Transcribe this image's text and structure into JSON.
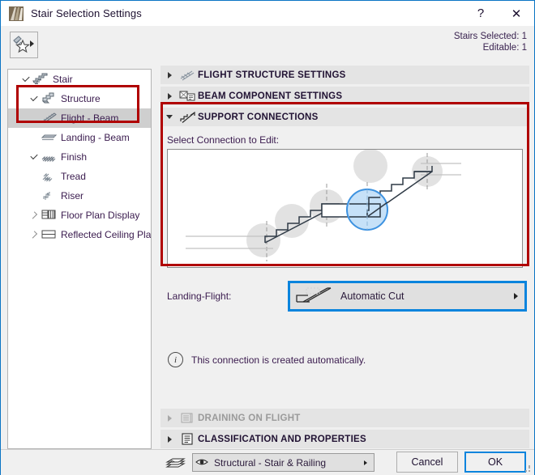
{
  "window": {
    "title": "Stair Selection Settings",
    "app_icon": "stair-app-icon",
    "help_label": "?",
    "close_label": "✕"
  },
  "header": {
    "favorites_icon": "favorites-star-icon",
    "stairs_selected": "Stairs Selected: 1",
    "editable": "Editable: 1"
  },
  "sidebar": {
    "items": [
      {
        "label": "Stair",
        "icon": "stair-icon",
        "indent": 0,
        "twisty": "open",
        "selected": false
      },
      {
        "label": "Structure",
        "icon": "structure-icon",
        "indent": 1,
        "twisty": "open",
        "selected": false
      },
      {
        "label": "Flight - Beam",
        "icon": "flight-beam-icon",
        "indent": 2,
        "twisty": "none",
        "selected": true
      },
      {
        "label": "Landing - Beam",
        "icon": "landing-beam-icon",
        "indent": 2,
        "twisty": "none",
        "selected": false
      },
      {
        "label": "Finish",
        "icon": "finish-icon",
        "indent": 1,
        "twisty": "open",
        "selected": false
      },
      {
        "label": "Tread",
        "icon": "tread-icon",
        "indent": 2,
        "twisty": "none",
        "selected": false
      },
      {
        "label": "Riser",
        "icon": "riser-icon",
        "indent": 2,
        "twisty": "none",
        "selected": false
      },
      {
        "label": "Floor Plan Display",
        "icon": "floor-plan-display-icon",
        "indent": 1,
        "twisty": "closed",
        "selected": false
      },
      {
        "label": "Reflected Ceiling Plan",
        "icon": "reflected-ceiling-plan-icon",
        "indent": 1,
        "twisty": "closed",
        "selected": false
      }
    ],
    "scroll_left_icon": "scroll-left-arrow-icon",
    "scroll_right_icon": "scroll-right-arrow-icon"
  },
  "main": {
    "sections_top": [
      {
        "title": "FLIGHT STRUCTURE SETTINGS",
        "icon": "flight-structure-icon",
        "expanded": false,
        "disabled": false
      },
      {
        "title": "BEAM COMPONENT SETTINGS",
        "icon": "beam-component-icon",
        "expanded": false,
        "disabled": false
      }
    ],
    "support_connections": {
      "title": "SUPPORT CONNECTIONS",
      "icon": "support-connections-icon",
      "expanded": true,
      "select_label": "Select Connection to Edit:",
      "diagram": {
        "name": "stair-connection-diagram",
        "node_count": 5,
        "selected_node_index": 3,
        "selected_node_color": "#4a9ee8",
        "node_color": "#e2e2e2",
        "stair_line_color": "#3a4450"
      },
      "landing_flight_label": "Landing-Flight:",
      "landing_flight_value": "Automatic Cut",
      "landing_flight_icon": "automatic-cut-icon",
      "landing_flight_arrow_icon": "chevron-right-icon",
      "info_icon": "info-icon",
      "info_text": "This connection is created automatically."
    },
    "sections_bottom": [
      {
        "title": "DRAINING ON FLIGHT",
        "icon": "draining-on-flight-icon",
        "expanded": false,
        "disabled": true
      },
      {
        "title": "CLASSIFICATION AND PROPERTIES",
        "icon": "classification-properties-icon",
        "expanded": false,
        "disabled": false
      }
    ]
  },
  "footer": {
    "layer_icon": "layers-icon",
    "layer_eye_icon": "eye-icon",
    "layer_value": "Structural - Stair & Railing",
    "layer_arrow_icon": "chevron-right-icon",
    "cancel_label": "Cancel",
    "ok_label": "OK",
    "resize_grip_icon": "resize-grip-icon"
  },
  "colors": {
    "accent_blue": "#0a84dd",
    "highlight_red": "#b00000",
    "selection_grey": "#cfcfcf",
    "panel_grey": "#f0f0f0",
    "section_grey": "#e4e4e4"
  }
}
